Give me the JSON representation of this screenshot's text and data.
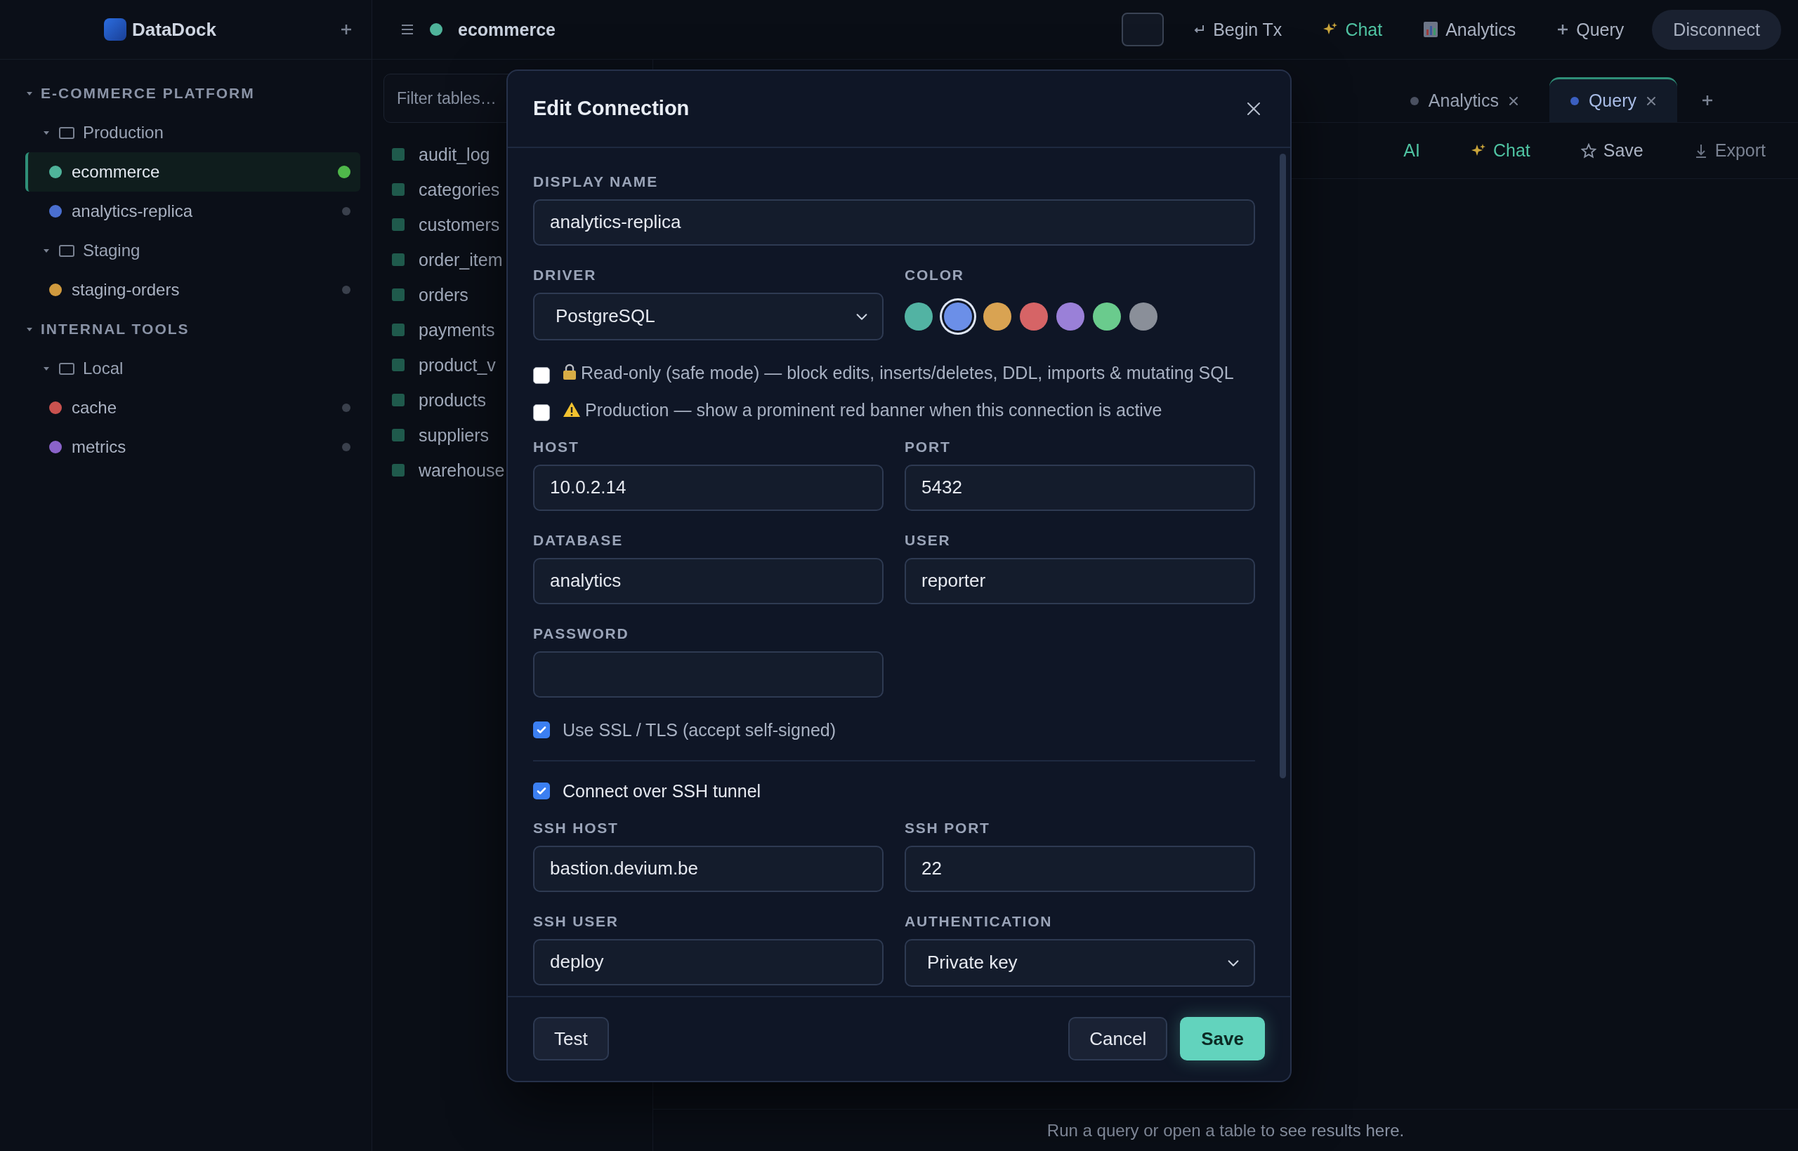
{
  "app": {
    "name": "DataDock"
  },
  "sidebar": {
    "groups": [
      {
        "title": "E-COMMERCE PLATFORM",
        "folders": [
          {
            "name": "Production",
            "connections": [
              {
                "name": "ecommerce",
                "color": "#4fb39a",
                "selected": true,
                "connected": true
              },
              {
                "name": "analytics-replica",
                "color": "#4a6fd0",
                "selected": false,
                "connected": false
              }
            ]
          },
          {
            "name": "Staging",
            "connections": [
              {
                "name": "staging-orders",
                "color": "#d09a3e",
                "selected": false,
                "connected": false
              }
            ]
          }
        ]
      },
      {
        "title": "INTERNAL TOOLS",
        "folders": [
          {
            "name": "Local",
            "connections": [
              {
                "name": "cache",
                "color": "#c9524f",
                "selected": false,
                "connected": false
              },
              {
                "name": "metrics",
                "color": "#8a63c9",
                "selected": false,
                "connected": false
              }
            ]
          }
        ]
      }
    ]
  },
  "topbar": {
    "connection": "ecommerce",
    "actions": [
      {
        "kind": "transaction",
        "label": "Begin Tx"
      },
      {
        "kind": "chat",
        "label": "Chat"
      },
      {
        "kind": "analytics",
        "label": "Analytics"
      },
      {
        "kind": "query",
        "label": "Query"
      }
    ],
    "disconnect": "Disconnect"
  },
  "tables": {
    "filter_placeholder": "Filter tables…",
    "items": [
      "audit_log",
      "categories",
      "customers",
      "order_item",
      "orders",
      "payments",
      "product_v",
      "products",
      "suppliers",
      "warehouse"
    ]
  },
  "tabs": [
    {
      "label": "Analytics",
      "selected": false
    },
    {
      "label": "Query",
      "selected": true
    }
  ],
  "toolbar": [
    {
      "kind": "ai",
      "label": "AI",
      "disabled": false
    },
    {
      "kind": "chat",
      "label": "Chat",
      "disabled": false
    },
    {
      "kind": "save",
      "label": "Save",
      "disabled": false
    },
    {
      "kind": "export",
      "label": "Export",
      "disabled": true
    }
  ],
  "results": {
    "empty_message": "Run a query or open a table to see results here."
  },
  "dialog": {
    "title": "Edit Connection",
    "display_name": {
      "label": "DISPLAY NAME",
      "value": "analytics-replica"
    },
    "driver": {
      "label": "DRIVER",
      "value": "PostgreSQL"
    },
    "color": {
      "label": "COLOR",
      "swatches": [
        {
          "color": "#52b3a3",
          "selected": false
        },
        {
          "color": "#6b8fe8",
          "selected": true
        },
        {
          "color": "#d9a352",
          "selected": false
        },
        {
          "color": "#d66466",
          "selected": false
        },
        {
          "color": "#9a80d8",
          "selected": false
        },
        {
          "color": "#6acb8d",
          "selected": false
        },
        {
          "color": "#8a8f99",
          "selected": false
        }
      ]
    },
    "options": [
      {
        "kind": "readonly",
        "label": "Read-only (safe mode) — block edits, inserts/deletes, DDL, imports & mutating SQL",
        "checked": false
      },
      {
        "kind": "production",
        "label": "Production — show a prominent red banner when this connection is active",
        "checked": false
      }
    ],
    "fields": [
      {
        "label": "HOST",
        "value": "10.0.2.14"
      },
      {
        "label": "PORT",
        "value": "5432"
      },
      {
        "label": "DATABASE",
        "value": "analytics"
      },
      {
        "label": "USER",
        "value": "reporter"
      },
      {
        "label": "PASSWORD"
      }
    ],
    "ssl": {
      "label": "Use SSL / TLS (accept self-signed)",
      "checked": true
    },
    "ssh": {
      "label": "Connect over SSH tunnel",
      "checked": true,
      "fields": [
        {
          "kind": "text",
          "label": "SSH HOST",
          "value": "bastion.devium.be"
        },
        {
          "kind": "text",
          "label": "SSH PORT",
          "value": "22"
        },
        {
          "kind": "text",
          "label": "SSH USER",
          "value": "deploy"
        },
        {
          "kind": "select",
          "label": "AUTHENTICATION",
          "value": "Private key"
        }
      ]
    },
    "buttons": {
      "test": "Test",
      "cancel": "Cancel",
      "save": "Save"
    }
  }
}
